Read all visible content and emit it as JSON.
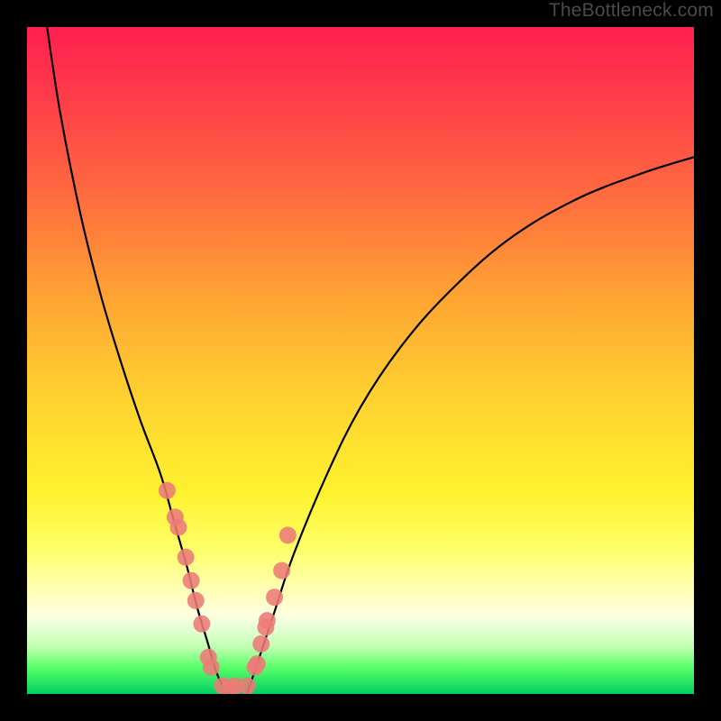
{
  "watermark": "TheBottleneck.com",
  "chart_data": {
    "type": "line",
    "title": "",
    "xlabel": "",
    "ylabel": "",
    "xlim": [
      0,
      100
    ],
    "ylim": [
      0,
      100
    ],
    "series": [
      {
        "name": "left-curve",
        "x": [
          3,
          5,
          8,
          11,
          14,
          17,
          20,
          22,
          24,
          25.5,
          27,
          28.5,
          30
        ],
        "values": [
          100,
          87,
          72,
          60,
          50,
          41,
          33,
          26,
          19,
          13,
          8,
          3,
          0
        ]
      },
      {
        "name": "right-curve",
        "x": [
          33,
          35,
          37,
          40,
          45,
          50,
          56,
          63,
          72,
          82,
          92,
          100
        ],
        "values": [
          0,
          6,
          12,
          21,
          33,
          43,
          52,
          60,
          68,
          74,
          78,
          80.5
        ]
      }
    ],
    "points": {
      "name": "highlight-points",
      "color": "#ec7b77",
      "x": [
        21.0,
        22.2,
        22.7,
        23.8,
        24.6,
        25.3,
        26.2,
        27.6,
        27.2,
        29.3,
        30.4,
        31.2,
        33.0,
        34.5,
        34.2,
        35.1,
        36.0,
        35.8,
        37.1,
        38.2,
        39.1
      ],
      "y": [
        30.5,
        26.5,
        25.0,
        20.5,
        17.0,
        14.0,
        10.5,
        4.0,
        5.5,
        1.2,
        1.0,
        1.2,
        1.2,
        4.5,
        4.0,
        7.5,
        11.0,
        10.0,
        14.5,
        18.5,
        23.8
      ]
    },
    "gradient_stops": [
      {
        "pos": 0.0,
        "color": "#ff1f4f"
      },
      {
        "pos": 0.1,
        "color": "#ff3b4a"
      },
      {
        "pos": 0.25,
        "color": "#ff6a3f"
      },
      {
        "pos": 0.4,
        "color": "#ffa233"
      },
      {
        "pos": 0.55,
        "color": "#ffd02f"
      },
      {
        "pos": 0.7,
        "color": "#fff22f"
      },
      {
        "pos": 0.78,
        "color": "#ffff66"
      },
      {
        "pos": 0.84,
        "color": "#ffffb0"
      },
      {
        "pos": 0.88,
        "color": "#ffffe0"
      },
      {
        "pos": 0.9,
        "color": "#e8ffd8"
      },
      {
        "pos": 0.93,
        "color": "#c0ffb0"
      },
      {
        "pos": 0.96,
        "color": "#5aff6a"
      },
      {
        "pos": 1.0,
        "color": "#00d060"
      }
    ]
  }
}
